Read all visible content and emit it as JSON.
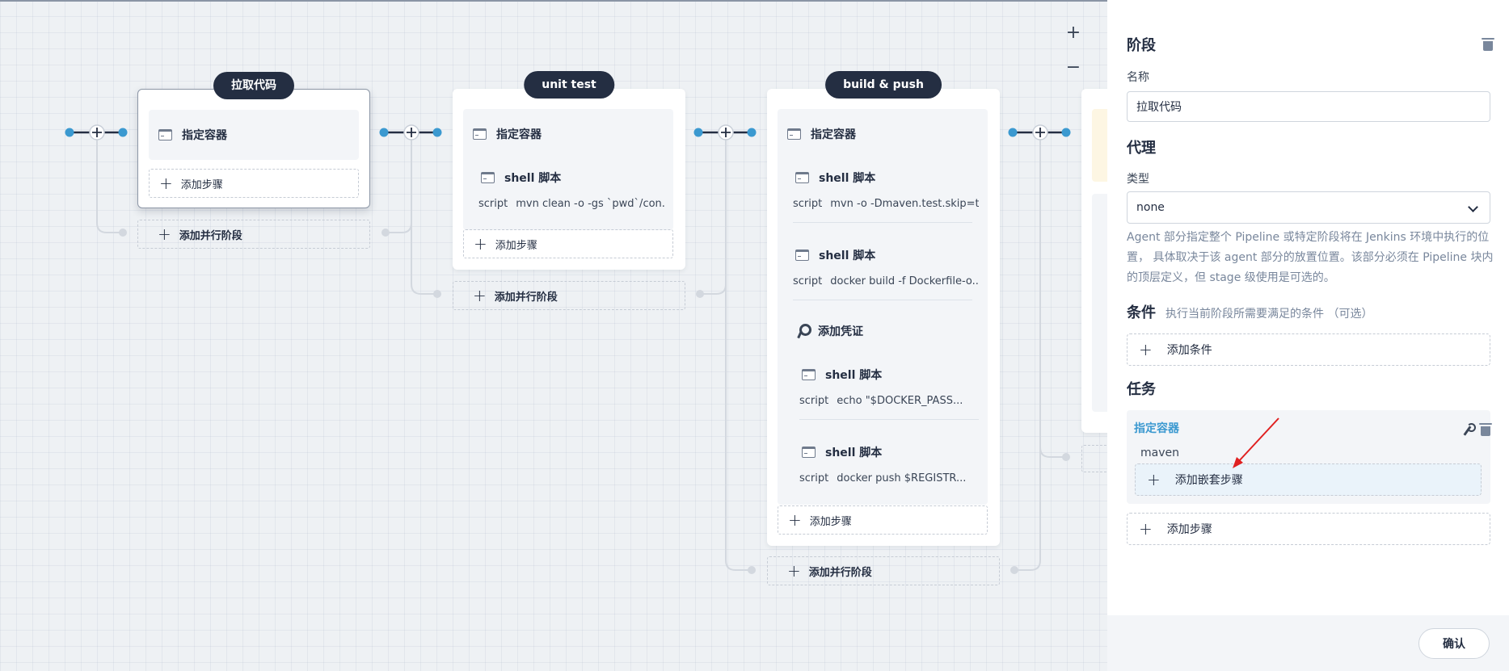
{
  "canvas": {
    "zoom_in": "+",
    "zoom_out": "−",
    "stages": [
      {
        "title": "拉取代码",
        "container_label": "指定容器",
        "add_step": "添加步骤",
        "add_parallel": "添加并行阶段"
      },
      {
        "title": "unit test",
        "container_label": "指定容器",
        "steps": [
          {
            "label": "shell 脚本",
            "script_key": "script",
            "script": "mvn clean -o -gs `pwd`/con..."
          }
        ],
        "add_step": "添加步骤",
        "add_parallel": "添加并行阶段"
      },
      {
        "title": "build & push",
        "container_label": "指定容器",
        "steps": [
          {
            "label": "shell 脚本",
            "script_key": "script",
            "script": "mvn -o -Dmaven.test.skip=t..."
          },
          {
            "label": "shell 脚本",
            "script_key": "script",
            "script": "docker build -f Dockerfile-o..."
          }
        ],
        "credential_label": "添加凭证",
        "nested_steps": [
          {
            "label": "shell 脚本",
            "script_key": "script",
            "script": "echo \"$DOCKER_PASS..."
          },
          {
            "label": "shell 脚本",
            "script_key": "script",
            "script": "docker push $REGISTR..."
          }
        ],
        "add_step": "添加步骤",
        "add_parallel": "添加并行阶段"
      }
    ]
  },
  "panel": {
    "stage_heading": "阶段",
    "name_label": "名称",
    "name_value": "拉取代码",
    "agent_heading": "代理",
    "type_label": "类型",
    "type_value": "none",
    "agent_desc": "Agent 部分指定整个 Pipeline 或特定阶段将在 Jenkins 环境中执行的位置， 具体取决于该 agent 部分的放置位置。该部分必须在 Pipeline 块内的顶层定义，但 stage 级使用是可选的。",
    "conditions_heading": "条件",
    "conditions_hint": "执行当前阶段所需要满足的条件 （可选）",
    "add_condition": "添加条件",
    "tasks_heading": "任务",
    "task": {
      "title": "指定容器",
      "value": "maven",
      "add_nested": "添加嵌套步骤"
    },
    "add_step": "添加步骤",
    "confirm": "确认"
  },
  "colors": {
    "node_blue": "#3b99d0",
    "dark": "#242e42",
    "link_blue": "#3b99d0",
    "annotation_red": "#e02020"
  },
  "icons": [
    "terminal-icon",
    "key-icon",
    "plus-icon",
    "trash-icon",
    "wrench-icon",
    "chevron-down-icon"
  ]
}
